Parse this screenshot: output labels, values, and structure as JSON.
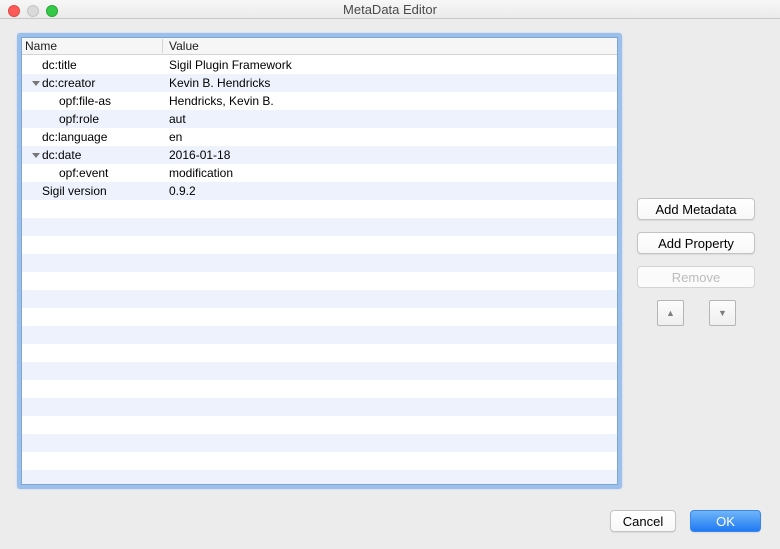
{
  "window": {
    "title": "MetaData Editor"
  },
  "titlebar": {
    "icons": [
      "close-traffic-light",
      "minimize-traffic-light",
      "zoom-traffic-light"
    ]
  },
  "colors": {
    "accent_blue": "#2a7ff4",
    "row_stripe_blue": "#edf2fc",
    "focus_ring_blue": "#9cc0ea",
    "traffic_red": "#fc5b57",
    "traffic_gray": "#dadada",
    "traffic_green": "#35c94a",
    "window_background": "#ececec"
  },
  "table": {
    "columns": [
      "Name",
      "Value"
    ],
    "rows": [
      {
        "name": "dc:title",
        "value": "Sigil Plugin Framework",
        "indent": 0,
        "expanded": false
      },
      {
        "name": "dc:creator",
        "value": "Kevin B. Hendricks",
        "indent": 0,
        "expanded": true
      },
      {
        "name": "opf:file-as",
        "value": "Hendricks, Kevin B.",
        "indent": 1,
        "expanded": false
      },
      {
        "name": "opf:role",
        "value": "aut",
        "indent": 1,
        "expanded": false
      },
      {
        "name": "dc:language",
        "value": "en",
        "indent": 0,
        "expanded": false
      },
      {
        "name": "dc:date",
        "value": "2016-01-18",
        "indent": 0,
        "expanded": true
      },
      {
        "name": "opf:event",
        "value": "modification",
        "indent": 1,
        "expanded": false
      },
      {
        "name": "Sigil version",
        "value": "0.9.2",
        "indent": 0,
        "expanded": false
      }
    ],
    "visible_row_slots": 24
  },
  "side_buttons": {
    "add_metadata": "Add Metadata",
    "add_property": "Add Property",
    "remove": "Remove",
    "move_up_icon": "▲",
    "move_down_icon": "▼"
  },
  "footer": {
    "cancel": "Cancel",
    "ok": "OK"
  }
}
